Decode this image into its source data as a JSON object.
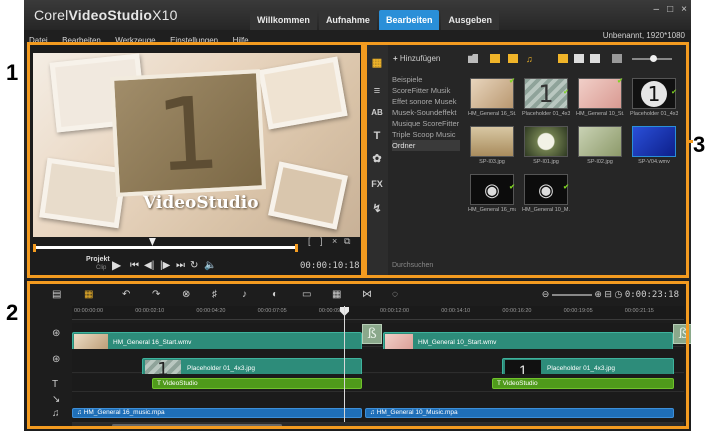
{
  "callouts": [
    "1",
    "2",
    "3"
  ],
  "app": {
    "brand_prefix": "Corel",
    "brand_name": "VideoStudio",
    "brand_version": "X10",
    "tabs": [
      {
        "label": "Willkommen",
        "active": false
      },
      {
        "label": "Aufnahme",
        "active": false
      },
      {
        "label": "Bearbeiten",
        "active": true
      },
      {
        "label": "Ausgeben",
        "active": false
      }
    ],
    "window_controls": [
      "–",
      "□",
      "×"
    ]
  },
  "menu": {
    "items": [
      "Datei",
      "Bearbeiten",
      "Werkzeuge",
      "Einstellungen",
      "Hilfe"
    ],
    "project_info": "Unbenannt, 1920*1080"
  },
  "player": {
    "preview_number": "1",
    "preview_text": "VideoStudio",
    "mode_project": "Projekt",
    "mode_clip": "Clip",
    "timecode": "00:00:10:18",
    "progress_fraction": 0.45,
    "trim_icons": [
      "[",
      "]",
      "×",
      "⧉"
    ]
  },
  "library": {
    "add_label": "Hinzufügen",
    "folders": [
      {
        "label": "Beispiele",
        "selected": false
      },
      {
        "label": "ScoreFitter Musik",
        "selected": false
      },
      {
        "label": "Effet sonore Musek",
        "selected": false
      },
      {
        "label": "Musek-Soundeffekt",
        "selected": false
      },
      {
        "label": "Musique ScoreFitter",
        "selected": false
      },
      {
        "label": "Triple Scoop Music",
        "selected": false
      },
      {
        "label": "Ordner",
        "selected": true
      }
    ],
    "thumbnails": [
      {
        "caption": "HM_General 16_St...",
        "kind": "photo-sepia",
        "checked": true
      },
      {
        "caption": "Placeholder 01_4x3...",
        "kind": "placeholder",
        "checked": true
      },
      {
        "caption": "HM_General 10_St...",
        "kind": "photo-pink",
        "checked": true
      },
      {
        "caption": "Placeholder 01_4x3...",
        "kind": "placeholder-dark",
        "checked": true
      },
      {
        "caption": "SP-I03.jpg",
        "kind": "flowers",
        "checked": false
      },
      {
        "caption": "SP-I01.jpg",
        "kind": "dandelion",
        "checked": false
      },
      {
        "caption": "SP-I02.jpg",
        "kind": "bokeh",
        "checked": false
      },
      {
        "caption": "SP-V04.wmv",
        "kind": "video-blue",
        "checked": false
      },
      {
        "caption": "HM_General 16_mu...",
        "kind": "audio",
        "checked": true
      },
      {
        "caption": "HM_General 10_M...",
        "kind": "audio",
        "checked": true
      }
    ],
    "bottom_label": "Durchsuchen"
  },
  "timeline": {
    "timecode": "0:00:23:18",
    "ticks": [
      "00:00:00:00",
      "00:00:02:10",
      "00:00:04:20",
      "00:00:07:05",
      "00:00:09:15",
      "00:00:12:00",
      "00:00:14:10",
      "00:00:16:20",
      "00:00:19:05",
      "00:00:21:15"
    ],
    "tracks": {
      "video": [
        {
          "label": "HM_General 16_Start.wmv"
        },
        {
          "label": "HM_General 10_Start.wmv"
        }
      ],
      "overlay": [
        {
          "label": "Placeholder 01_4x3.jpg"
        },
        {
          "label": "Placeholder 01_4x3.jpg"
        }
      ],
      "title": [
        {
          "label": "VideoStudio"
        },
        {
          "label": "VideoStudio"
        }
      ],
      "music": [
        {
          "label": "HM_General 16_music.mpa"
        },
        {
          "label": "HM_General 10_Music.mpa"
        }
      ]
    }
  },
  "colors": {
    "callout_frame": "#f39b20",
    "active_tab": "#2a8fd8",
    "video_clip": "#2d8c7a",
    "title_clip": "#4f9a1b",
    "music_clip": "#1f6fb8"
  }
}
